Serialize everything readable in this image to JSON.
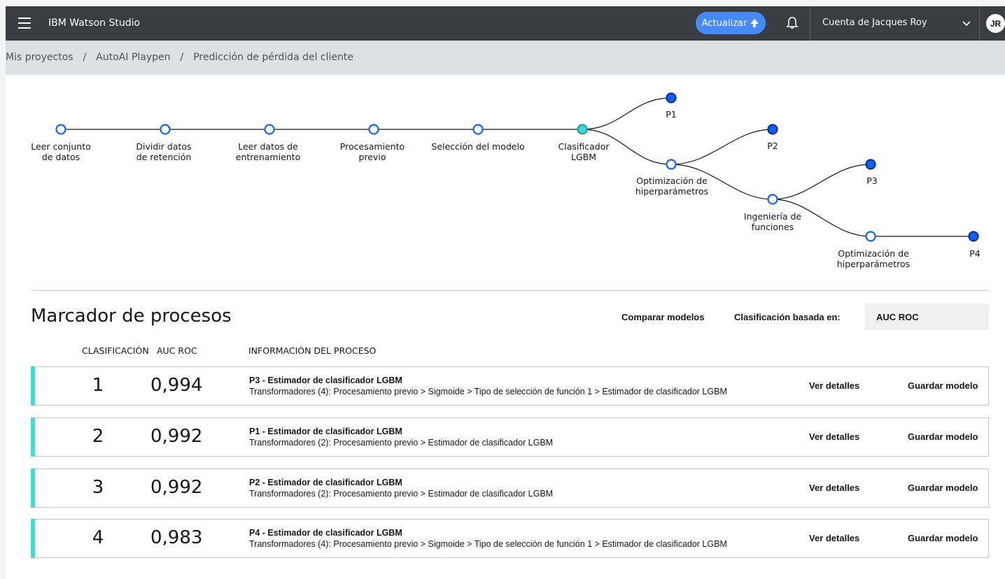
{
  "topbar": {
    "brand": "IBM Watson Studio",
    "update_label": "Actualizar",
    "account_label": "Cuenta de Jacques Roy",
    "avatar_initials": "JR",
    "update_color": "#4589ff"
  },
  "breadcrumb": [
    "Mis proyectos",
    "AutoAI Playpen",
    "Predicción de pérdida del cliente"
  ],
  "pipeline": {
    "nodes": [
      {
        "label": "Leer conjunto\nde datos"
      },
      {
        "label": "Dividir datos\nde retención"
      },
      {
        "label": "Leer datos de\nentrenamiento"
      },
      {
        "label": "Procesamiento\nprevio"
      },
      {
        "label": "Selección del modelo"
      },
      {
        "label": "Clasificador\nLGBM"
      },
      {
        "label": "Optimización de\nhiperparámetros"
      },
      {
        "label": "Ingeniería de\nfunciones"
      },
      {
        "label": "Optimización de\nhiperparámetros"
      },
      {
        "label": "P1"
      },
      {
        "label": "P2"
      },
      {
        "label": "P3"
      },
      {
        "label": "P4"
      }
    ]
  },
  "leaderboard": {
    "title": "Marcador de procesos",
    "compare_label": "Comparar modelos",
    "rank_by_label": "Clasificación basada en:",
    "rank_by_value": "AUC ROC",
    "columns": {
      "rank": "CLASIFICACIÓN",
      "metric": "AUC ROC",
      "info": "INFORMACIÓN DEL PROCESO"
    },
    "rows": [
      {
        "rank": "1",
        "score": "0,994",
        "name": "P3 - Estimador de clasificador LGBM",
        "desc": "Transformadores (4): Procesamiento previo > Sigmoide > Tipo de selección de función 1 > Estimador de clasificador LGBM",
        "details": "Ver detalles",
        "save": "Guardar modelo"
      },
      {
        "rank": "2",
        "score": "0,992",
        "name": "P1 - Estimador de clasificador LGBM",
        "desc": "Transformadores (2): Procesamiento previo > Estimador de clasificador LGBM",
        "details": "Ver detalles",
        "save": "Guardar modelo"
      },
      {
        "rank": "3",
        "score": "0,992",
        "name": "P2 - Estimador de clasificador LGBM",
        "desc": "Transformadores (2): Procesamiento previo > Estimador de clasificador LGBM",
        "details": "Ver detalles",
        "save": "Guardar modelo"
      },
      {
        "rank": "4",
        "score": "0,983",
        "name": "P4 - Estimador de clasificador LGBM",
        "desc": "Transformadores (4): Procesamiento previo > Sigmoide > Tipo de selección de función 1 > Estimador de clasificador LGBM",
        "details": "Ver detalles",
        "save": "Guardar modelo"
      }
    ]
  },
  "colors": {
    "accent": "#3ddbd9",
    "node_blue": "#0f62fe",
    "node_done": "#0043ce",
    "node_active": "#3ddbd9"
  }
}
